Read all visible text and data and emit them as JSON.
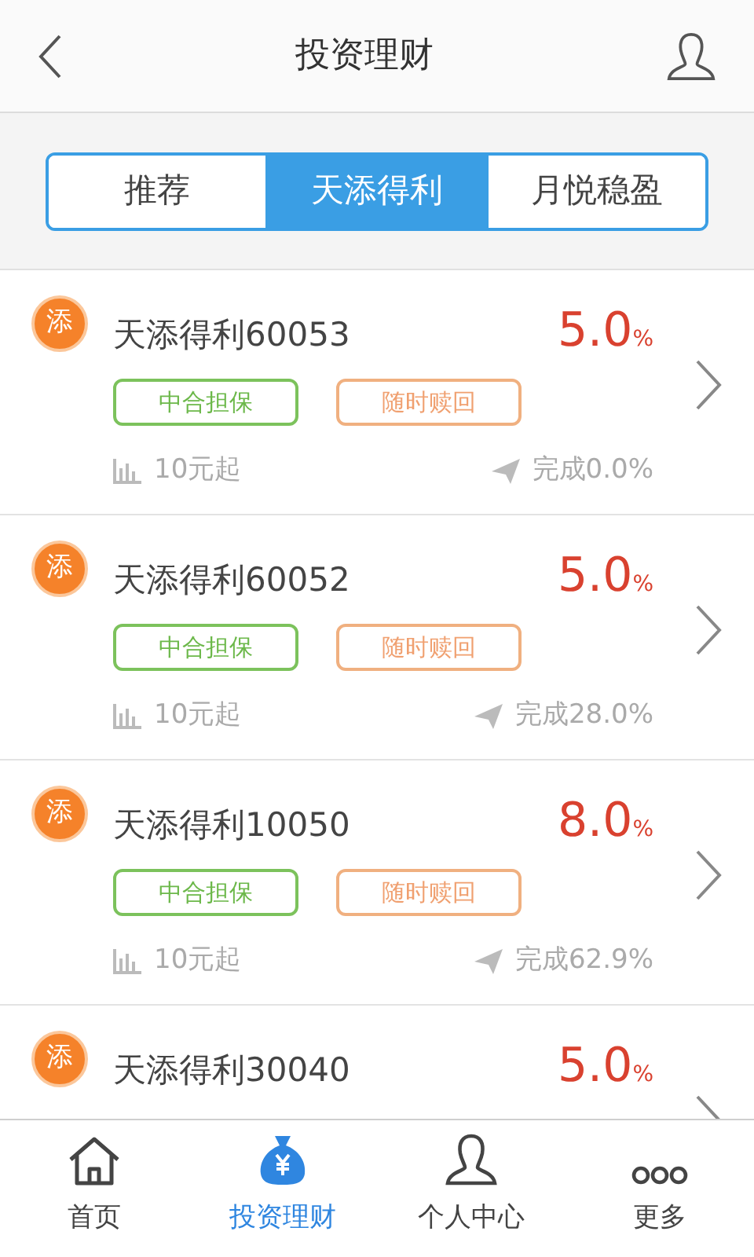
{
  "header": {
    "title": "投资理财"
  },
  "tabs": [
    {
      "label": "推荐",
      "selected": false
    },
    {
      "label": "天添得利",
      "selected": true
    },
    {
      "label": "月悦稳盈",
      "selected": false
    }
  ],
  "products": [
    {
      "badge": "添",
      "name": "天添得利60053",
      "rate": "5.0",
      "unit": "%",
      "tags": [
        "中合担保",
        "随时赎回"
      ],
      "min": "10元起",
      "progress": "完成0.0%"
    },
    {
      "badge": "添",
      "name": "天添得利60052",
      "rate": "5.0",
      "unit": "%",
      "tags": [
        "中合担保",
        "随时赎回"
      ],
      "min": "10元起",
      "progress": "完成28.0%"
    },
    {
      "badge": "添",
      "name": "天添得利10050",
      "rate": "8.0",
      "unit": "%",
      "tags": [
        "中合担保",
        "随时赎回"
      ],
      "min": "10元起",
      "progress": "完成62.9%"
    },
    {
      "badge": "添",
      "name": "天添得利30040",
      "rate": "5.0",
      "unit": "%"
    }
  ],
  "nav": [
    {
      "label": "首页",
      "selected": false
    },
    {
      "label": "投资理财",
      "selected": true
    },
    {
      "label": "个人中心",
      "selected": false
    },
    {
      "label": "更多",
      "selected": false
    }
  ]
}
